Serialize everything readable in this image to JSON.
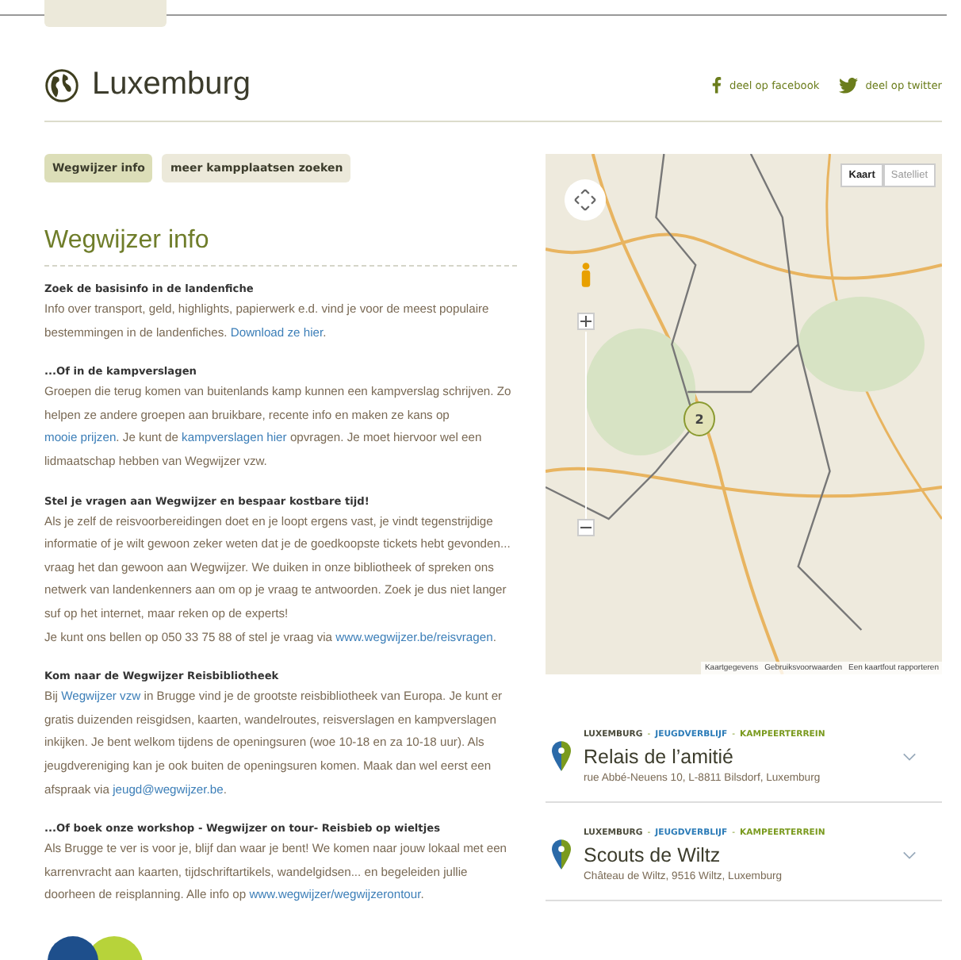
{
  "page_title": "Luxemburg",
  "share_links": [
    {
      "kind": "facebook",
      "label": "deel op facebook"
    },
    {
      "kind": "twitter",
      "label": "deel op twitter"
    }
  ],
  "tabs": [
    {
      "label": "Wegwijzer info",
      "selected": true
    },
    {
      "label": "meer kampplaatsen zoeken",
      "selected": false
    }
  ],
  "section_title": "Wegwijzer info",
  "sections": [
    {
      "heading": "Zoek de basisinfo in de landenfiche",
      "lines": [
        [
          {
            "kind": "text",
            "text": "Info over transport, geld, highlights, papierwerk e.d. vind je voor de meest populaire bestemmingen in de landenfiches. "
          },
          {
            "kind": "link",
            "text": "Download ze hier"
          },
          {
            "kind": "text",
            "text": "."
          }
        ]
      ]
    },
    {
      "heading": "...Of in de kampverslagen",
      "lines": [
        [
          {
            "kind": "text",
            "text": "Groepen die terug komen van buitenlands kamp kunnen een kampverslag schrijven. Zo helpen ze andere groepen aan bruikbare, recente info en maken ze kans op "
          },
          {
            "kind": "link",
            "text": "mooie prijzen"
          },
          {
            "kind": "text",
            "text": ".  Je kunt de "
          },
          {
            "kind": "link",
            "text": "kampverslagen hier"
          },
          {
            "kind": "text",
            "text": " opvragen. Je moet hiervoor wel een lidmaatschap hebben van Wegwijzer vzw."
          }
        ]
      ]
    },
    {
      "heading": "Stel je vragen aan Wegwijzer en bespaar kostbare tijd!",
      "lines": [
        [
          {
            "kind": "text",
            "text": "Als je zelf de reisvoorbereidingen doet en je loopt ergens vast, je vindt tegenstrijdige informatie of je wilt gewoon zeker weten dat je de goedkoopste tickets hebt gevonden... vraag het dan gewoon aan Wegwijzer. We duiken in onze bibliotheek of spreken ons netwerk van landenkenners aan om op je vraag te antwoorden. Zoek je dus niet langer suf op het internet, maar reken op de experts!"
          }
        ],
        [
          {
            "kind": "text",
            "text": "Je kunt ons bellen op 050 33 75 88 of stel je vraag via "
          },
          {
            "kind": "link",
            "text": "www.wegwijzer.be/reisvragen"
          },
          {
            "kind": "text",
            "text": "."
          }
        ]
      ]
    },
    {
      "heading": "Kom naar de Wegwijzer Reisbibliotheek",
      "lines": [
        [
          {
            "kind": "text",
            "text": "Bij "
          },
          {
            "kind": "link",
            "text": "Wegwijzer vzw"
          },
          {
            "kind": "text",
            "text": " in Brugge vind je de grootste reisbibliotheek van Europa. Je kunt er gratis duizenden reisgidsen, kaarten, wandelroutes, reisverslagen en kampverslagen inkijken. Je bent welkom tijdens de openingsuren (woe 10-18 en za 10-18 uur). Als jeugdvereniging kan je ook buiten de openingsuren komen. Maak dan wel eerst een afspraak via "
          },
          {
            "kind": "link",
            "text": "jeugd@wegwijzer.be"
          },
          {
            "kind": "text",
            "text": "."
          }
        ]
      ]
    },
    {
      "heading": "...Of boek onze workshop - Wegwijzer on tour- Reisbieb op wieltjes",
      "lines": [
        [
          {
            "kind": "text",
            "text": "Als Brugge te ver is voor je, blijf dan waar je bent! We komen naar jouw lokaal met een karrenvracht aan kaarten, tijdschriftartikels, wandelgidsen... en begeleiden jullie doorheen de reisplanning. Alle info op "
          },
          {
            "kind": "link",
            "text": "www.wegwijzer/wegwijzerontour"
          },
          {
            "kind": "text",
            "text": "."
          }
        ]
      ]
    }
  ],
  "map": {
    "types": [
      {
        "label": "Kaart",
        "selected": true
      },
      {
        "label": "Satelliet",
        "selected": false
      }
    ],
    "cluster": "2",
    "footer": [
      "Kaartgegevens",
      "Gebruiksvoorwaarden",
      "Een kaartfout rapporteren"
    ]
  },
  "places": [
    {
      "tags": [
        {
          "kind": "tag",
          "label": "LUXEMBURG",
          "color": "#4a4a3a"
        },
        {
          "kind": "separator",
          "label": "-"
        },
        {
          "kind": "tag",
          "label": "JEUGDVERBLIJF",
          "color": "#2d7cb8"
        },
        {
          "kind": "separator",
          "label": "-"
        },
        {
          "kind": "tag",
          "label": "KAMPEERTERREIN",
          "color": "#7a9a1e"
        }
      ],
      "name": "Relais de l’amitié",
      "address": "rue Abbé-Neuens 10, L-8811 Bilsdorf, Luxemburg"
    },
    {
      "tags": [
        {
          "kind": "tag",
          "label": "LUXEMBURG",
          "color": "#4a4a3a"
        },
        {
          "kind": "separator",
          "label": "-"
        },
        {
          "kind": "tag",
          "label": "JEUGDVERBLIJF",
          "color": "#2d7cb8"
        },
        {
          "kind": "separator",
          "label": "-"
        },
        {
          "kind": "tag",
          "label": "KAMPEERTERREIN",
          "color": "#7a9a1e"
        }
      ],
      "name": "Scouts de Wiltz",
      "address": "Château de Wiltz, 9516 Wiltz, Luxemburg"
    }
  ]
}
